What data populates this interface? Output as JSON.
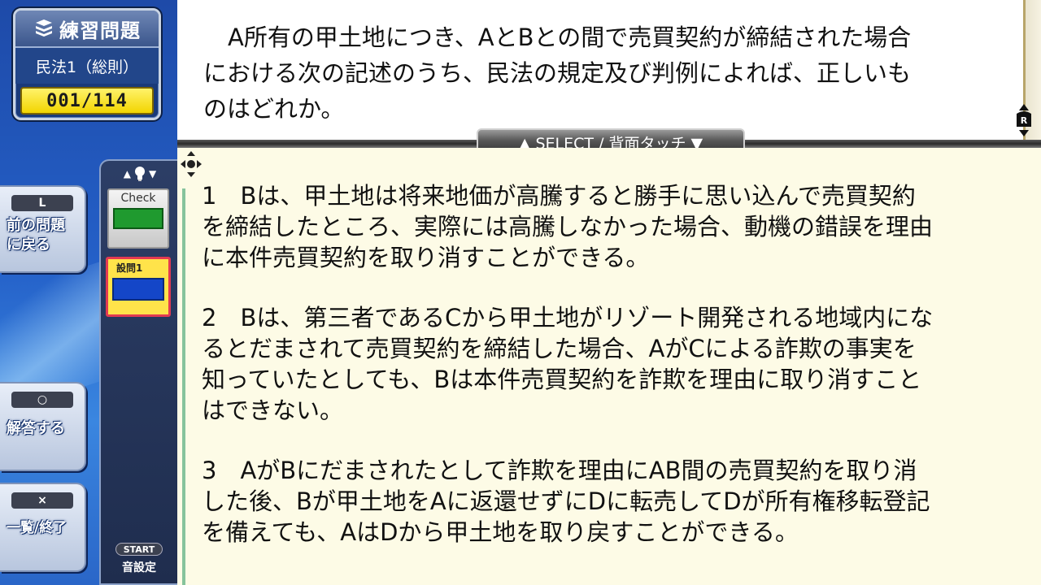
{
  "sidebar": {
    "title": "練習問題",
    "subject": "民法1（総則）",
    "counter": "001/114",
    "buttons": {
      "prev": {
        "key": "L",
        "label_line1": "前の問題",
        "label_line2": "に戻る"
      },
      "answer": {
        "key": "○",
        "label": "解答する"
      },
      "exit": {
        "key": "×",
        "label": "一覧/終了"
      }
    },
    "check_panel": {
      "check_label": "Check",
      "question_label": "設問1",
      "start_key": "START",
      "sound_label": "音設定"
    }
  },
  "main": {
    "question": "A所有の甲土地につき、AとBとの間で売買契約が締結された場合における次の記述のうち、民法の規定及び判例によれば、正しいものはどれか。",
    "select_bar": "▲ SELECT / 背面タッチ ▼",
    "choices": [
      "1　Bは、甲土地は将来地価が高騰すると勝手に思い込んで売買契約を締結したところ、実際には高騰しなかった場合、動機の錯誤を理由に本件売買契約を取り消すことができる。",
      "2　Bは、第三者であるCから甲土地がリゾート開発される地域内になるとだまされて売買契約を締結した場合、AがCによる詐欺の事実を知っていたとしても、Bは本件売買契約を詐欺を理由に取り消すことはできない。",
      "3　AがBにだまされたとして詐欺を理由にAB間の売買契約を取り消した後、Bが甲土地をAに返還せずにDに転売してDが所有権移転登記を備えても、AはDから甲土地を取り戻すことができる。"
    ]
  },
  "icons": {
    "title": "book-icon",
    "nav": "lightbulb-icon",
    "r_button": "r-shoulder-icon",
    "move": "move-cross-icon"
  },
  "colors": {
    "sidebar_blue": "#2460c8",
    "counter_yellow": "#f2d500",
    "check_green": "#1f9a2f",
    "question_card_yellow": "#ffe34a",
    "question_card_border": "#e23a52",
    "answer_pane_bg": "#fdfbe6"
  }
}
